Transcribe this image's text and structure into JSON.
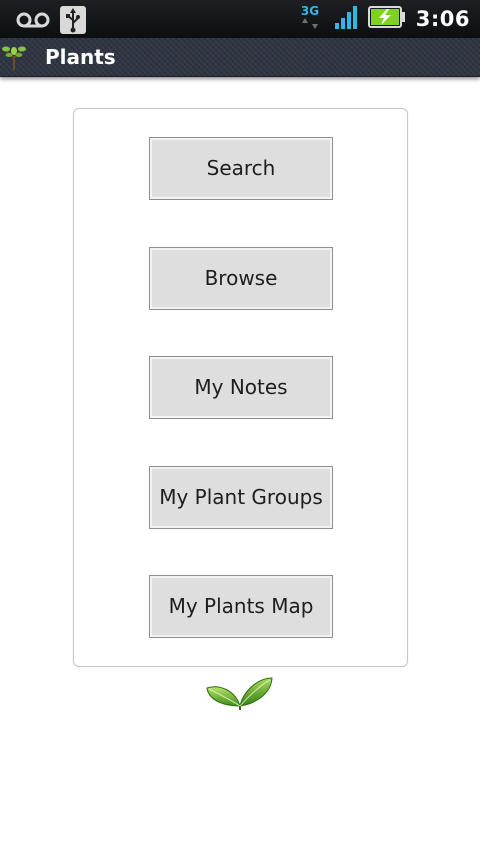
{
  "status_bar": {
    "time": "3:06",
    "network_type": "3G",
    "icons": [
      "voicemail-icon",
      "usb-icon",
      "3g-data-icon",
      "signal-strength-icon",
      "battery-charging-icon"
    ],
    "colors": {
      "network_accent": "#33b5e5",
      "battery_fill": "#7ed321"
    }
  },
  "title_bar": {
    "title": "Plants",
    "icon": "plant-app-icon"
  },
  "menu": {
    "buttons": [
      {
        "label": "Search"
      },
      {
        "label": "Browse"
      },
      {
        "label": "My Notes"
      },
      {
        "label": "My Plant Groups"
      },
      {
        "label": "My Plants Map"
      }
    ]
  },
  "footer": {
    "icon": "green-leaves-icon"
  },
  "colors": {
    "title_bar_bg": "#2e3441",
    "button_bg": "#dedede",
    "leaf_green": "#5aa82a"
  }
}
